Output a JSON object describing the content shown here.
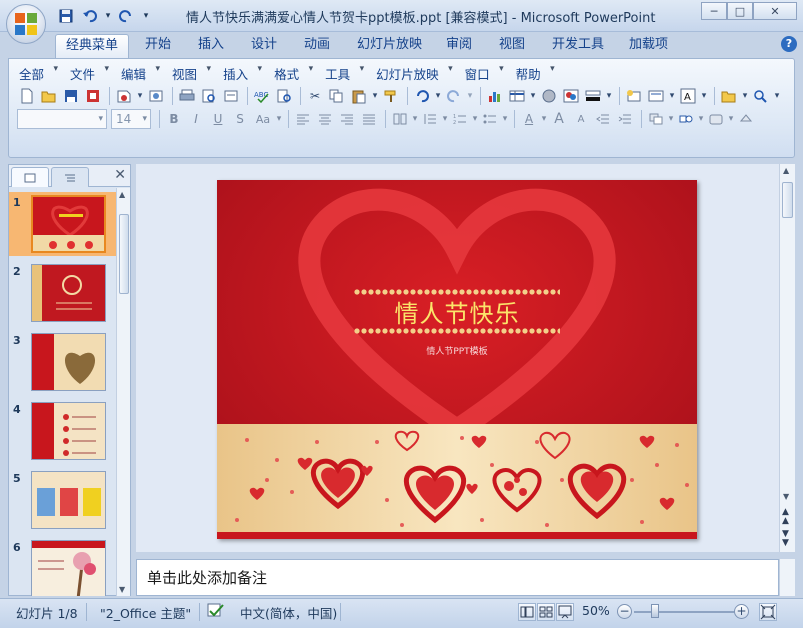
{
  "window": {
    "title": "情人节快乐满满爱心情人节贺卡ppt模板.ppt [兼容模式] - Microsoft PowerPoint",
    "min_label": "─",
    "max_label": "□",
    "close_label": "✕"
  },
  "quick_access": {
    "more_label": "▾"
  },
  "ribbon_tabs": [
    {
      "label": "经典菜单",
      "active": true
    },
    {
      "label": "开始"
    },
    {
      "label": "插入"
    },
    {
      "label": "设计"
    },
    {
      "label": "动画"
    },
    {
      "label": "幻灯片放映"
    },
    {
      "label": "审阅"
    },
    {
      "label": "视图"
    },
    {
      "label": "开发工具"
    },
    {
      "label": "加载项"
    }
  ],
  "help_label": "?",
  "classic_menu": [
    "全部",
    "文件",
    "编辑",
    "视图",
    "插入",
    "格式",
    "工具",
    "幻灯片放映",
    "窗口",
    "帮助"
  ],
  "font_size_value": "14",
  "font_name_value": "",
  "format_buttons": {
    "bold": "B",
    "italic": "I",
    "underline": "U",
    "strike": "S",
    "case": "Aa",
    "font_color": "A",
    "grow": "A",
    "shrink": "A",
    "text_box": "A"
  },
  "slide_panel": {
    "close_label": "✕",
    "slides": [
      {
        "num": "1",
        "selected": true
      },
      {
        "num": "2"
      },
      {
        "num": "3"
      },
      {
        "num": "4"
      },
      {
        "num": "5"
      },
      {
        "num": "6"
      }
    ]
  },
  "slide": {
    "title": "情人节快乐",
    "subtitle": "情人节PPT模板",
    "colors": {
      "red": "#c8161d",
      "gold": "#f3d9a4"
    }
  },
  "notes_placeholder": "单击此处添加备注",
  "status": {
    "slide_info": "幻灯片 1/8",
    "theme": "\"2_Office 主题\"",
    "language": "中文(简体，中国)",
    "zoom": "50%"
  }
}
